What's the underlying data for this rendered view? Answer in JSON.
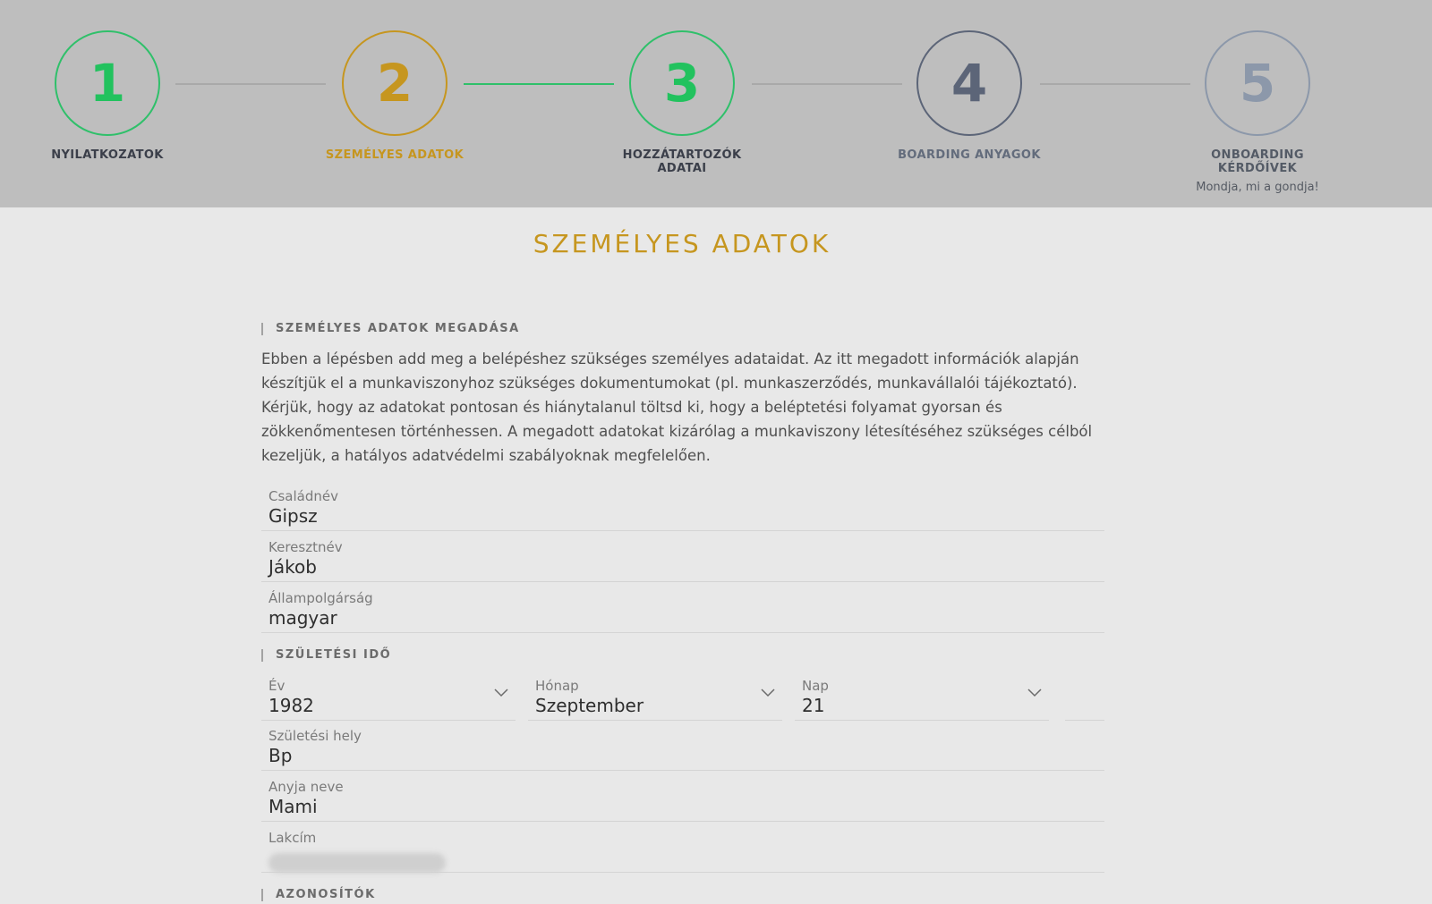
{
  "stepper": {
    "steps": [
      {
        "number": "1",
        "label": "NYILATKOZATOK",
        "state": "completed"
      },
      {
        "number": "2",
        "label": "SZEMÉLYES ADATOK",
        "state": "current"
      },
      {
        "number": "3",
        "label": "HOZZÁTARTOZÓK ADATAI",
        "state": "completed"
      },
      {
        "number": "4",
        "label": "BOARDING ANYAGOK",
        "state": "upcoming"
      },
      {
        "number": "5",
        "label": "ONBOARDING KÉRDŐÍVEK",
        "state": "upcoming",
        "sublabel": "Mondja, mi a gondja!"
      }
    ]
  },
  "page": {
    "title": "SZEMÉLYES ADATOK"
  },
  "personal": {
    "section_label": "SZEMÉLYES ADATOK MEGADÁSA",
    "intro": "Ebben a lépésben add meg a belépéshez szükséges személyes adataidat. Az itt megadott információk alapján készítjük el a munkaviszonyhoz szükséges dokumentumokat (pl. munkaszerződés, munkavállalói tájékoztató). Kérjük, hogy az adatokat pontosan és hiánytalanul töltsd ki, hogy a beléptetési folyamat gyorsan és zökkenőmentesen történhessen. A megadott adatokat kizárólag a munkaviszony létesítéséhez szükséges célból kezeljük, a hatályos adatvédelmi szabályoknak megfelelően.",
    "last_name": {
      "label": "Családnév",
      "value": "Gipsz"
    },
    "first_name": {
      "label": "Keresztnév",
      "value": "Jákob"
    },
    "citizenship": {
      "label": "Állampolgárság",
      "value": "magyar"
    }
  },
  "birth": {
    "section_label": "SZÜLETÉSI IDŐ",
    "year": {
      "label": "Év",
      "value": "1982"
    },
    "month": {
      "label": "Hónap",
      "value": "Szeptember"
    },
    "day": {
      "label": "Nap",
      "value": "21"
    },
    "place": {
      "label": "Születési hely",
      "value": "Bp"
    },
    "mother_name": {
      "label": "Anyja neve",
      "value": "Mami"
    },
    "address": {
      "label": "Lakcím"
    }
  },
  "identifiers": {
    "section_label": "AZONOSÍTÓK"
  },
  "colors": {
    "accent_gold": "#c6961f",
    "success_green": "#22c25e",
    "header_bg": "#bebebe",
    "page_bg": "#e8e8e8"
  }
}
